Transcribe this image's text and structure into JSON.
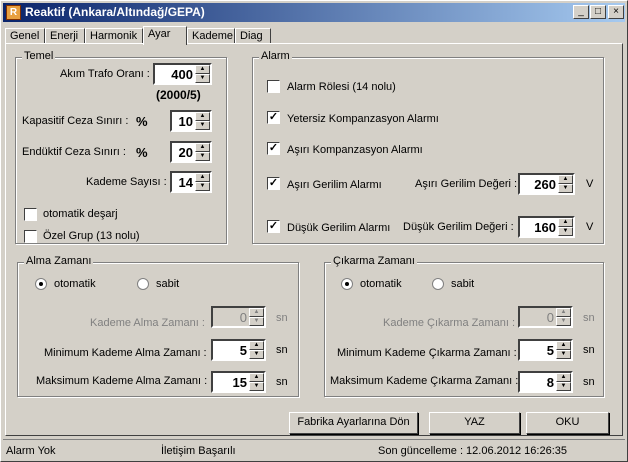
{
  "window": {
    "title": "Reaktif  (Ankara/Altındağ/GEPA)"
  },
  "tabs": [
    "Genel",
    "Enerji",
    "Harmonik",
    "Ayar",
    "Kademe",
    "Diag"
  ],
  "temel": {
    "title": "Temel",
    "akim_label": "Akım Trafo Oranı :",
    "akim_value": "400",
    "akim_note": "(2000/5)",
    "kap_label": "Kapasitif Ceza Sınırı :",
    "kap_pct": "%",
    "kap_value": "10",
    "end_label": "Endüktif Ceza Sınırı :",
    "end_pct": "%",
    "end_value": "20",
    "kad_label": "Kademe Sayısı :",
    "kad_value": "14",
    "otomatik_label": "otomatik deşarj",
    "ozel_label": "Özel Grup (13 nolu)"
  },
  "alarm": {
    "title": "Alarm",
    "role_label": "Alarm Rölesi (14 nolu)",
    "yetersiz_label": "Yetersiz Kompanzasyon Alarmı",
    "asiri_komp_label": "Aşırı Kompanzasyon Alarmı",
    "asiri_ger_label": "Aşırı Gerilim Alarmı",
    "asiri_deger_label": "Aşırı Gerilim Değeri :",
    "asiri_deger_value": "260",
    "asiri_unit": "V",
    "dusuk_label": "Düşük Gerilim Alarmı",
    "dusuk_deger_label": "Düşük Gerilim Değeri :",
    "dusuk_deger_value": "160",
    "dusuk_unit": "V"
  },
  "alma": {
    "title": "Alma Zamanı",
    "otomatik": "otomatik",
    "sabit": "sabit",
    "kademe_label": "Kademe Alma Zamanı :",
    "kademe_value": "0",
    "min_label": "Minimum Kademe Alma Zamanı :",
    "min_value": "5",
    "max_label": "Maksimum Kademe Alma Zamanı :",
    "max_value": "15",
    "unit": "sn"
  },
  "cikarma": {
    "title": "Çıkarma Zamanı",
    "otomatik": "otomatik",
    "sabit": "sabit",
    "kademe_label": "Kademe Çıkarma Zamanı :",
    "kademe_value": "0",
    "min_label": "Minimum Kademe Çıkarma Zamanı :",
    "min_value": "5",
    "max_label": "Maksimum Kademe Çıkarma Zamanı :",
    "max_value": "8",
    "unit": "sn"
  },
  "buttons": {
    "fabrika": "Fabrika Ayarlarına Dön",
    "yaz": "YAZ",
    "oku": "OKU"
  },
  "status": {
    "alarm": "Alarm Yok",
    "iletisim": "İletişim Başarılı",
    "guncelleme": "Son güncelleme : 12.06.2012 16:26:35"
  }
}
